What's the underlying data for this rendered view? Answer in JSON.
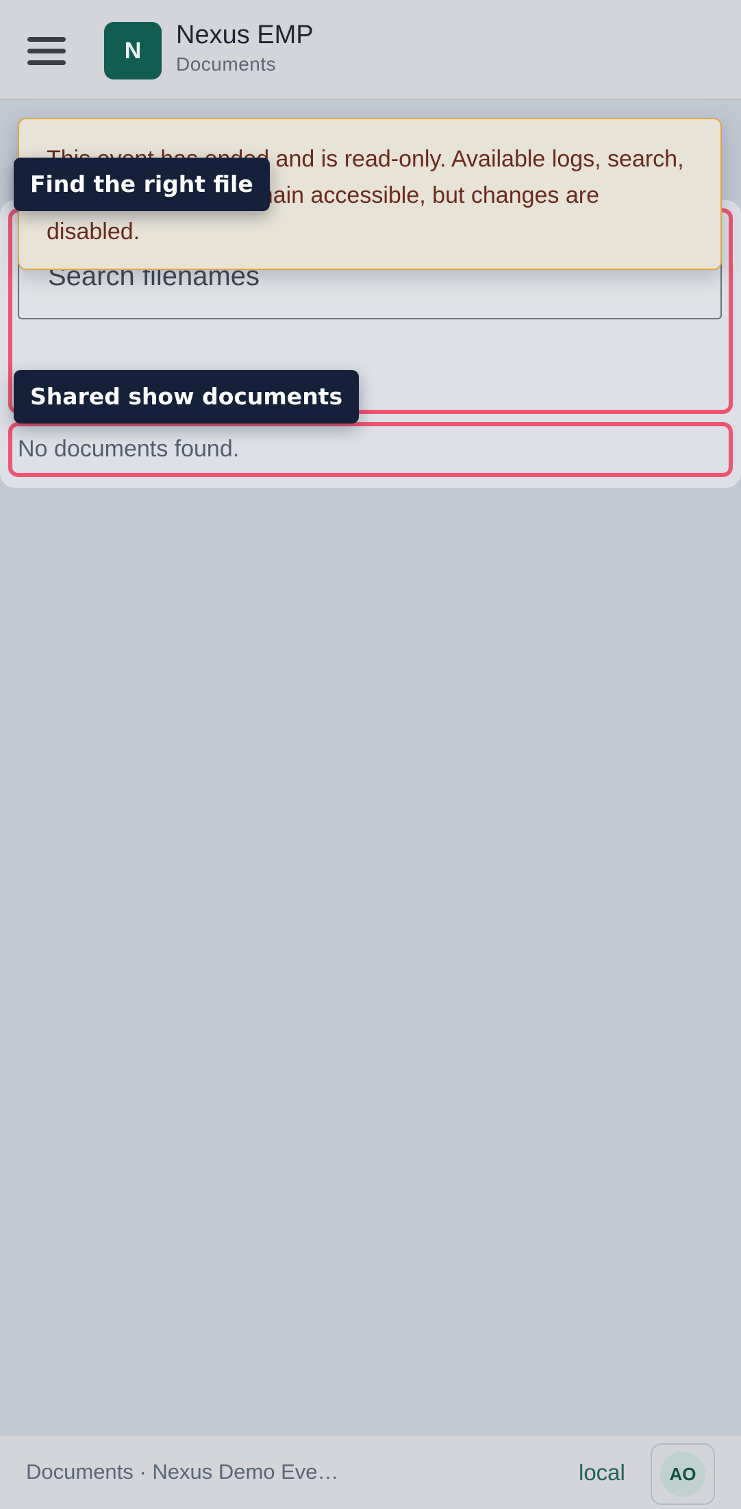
{
  "header": {
    "logo_letter": "N",
    "app_title": "Nexus EMP",
    "page_subtitle": "Documents"
  },
  "banner": {
    "message": "This event has ended and is read-only. Available logs, search, print, and exports remain accessible, but changes are disabled."
  },
  "search": {
    "placeholder": "Search filenames"
  },
  "documents": {
    "empty_text": "No documents found."
  },
  "tours": {
    "find_label": "Find the right file",
    "shared_label": "Shared show documents"
  },
  "footer": {
    "breadcrumb": "Documents · Nexus Demo Eve…",
    "environment": "local",
    "avatar_initials": "AO"
  },
  "colors": {
    "brand": "#125d52",
    "highlight": "#ef5470",
    "banner_border": "#e2a53c",
    "tag_bg": "#15203a"
  }
}
